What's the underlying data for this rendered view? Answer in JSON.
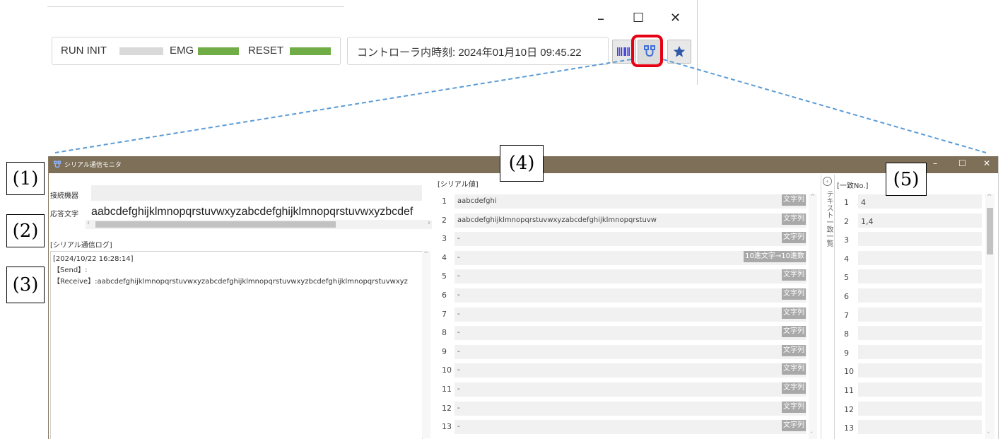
{
  "top": {
    "status": {
      "run_init": "RUN INIT",
      "emg": "EMG",
      "reset": "RESET"
    },
    "controller_time": "コントローラ内時刻: 2024年01月10日 09:45.22",
    "window_controls": {
      "minimize": "–",
      "maximize": "☐",
      "close": "✕"
    },
    "toolbar_icons": [
      "barcode-icon",
      "serial-connector-icon",
      "star-icon"
    ]
  },
  "monitor": {
    "title": "シリアル通信モニタ",
    "window_controls": {
      "minimize": "–",
      "maximize": "☐",
      "close": "✕"
    },
    "connected_device_label": "接続機器",
    "connected_device_value": "",
    "response_label": "応答文字",
    "response_value": "aabcdefghijklmnopqrstuvwxyzabcdefghijklmnopqrstuvwxyzbcdef",
    "log_header": "[シリアル通信ログ]",
    "log_lines": [
      "[2024/10/22 16:28:14]",
      "【Send】:",
      "【Receive】:aabcdefghijklmnopqrstuvwxyzabcdefghijklmnopqrstuvwxyzbcdefghijklmnopqrstuvwxyz"
    ],
    "serial_header": "[シリアル値]",
    "serial_rows": [
      {
        "no": "1",
        "value": "aabcdefghi",
        "tag": "文字列"
      },
      {
        "no": "2",
        "value": "aabcdefghijklmnopqrstuvwxyzabcdefghijklmnopqrstuvw",
        "tag": "文字列"
      },
      {
        "no": "3",
        "value": "-",
        "tag": "文字列"
      },
      {
        "no": "4",
        "value": "-",
        "tag": "10進文字→10進数"
      },
      {
        "no": "5",
        "value": "-",
        "tag": "文字列"
      },
      {
        "no": "6",
        "value": "-",
        "tag": "文字列"
      },
      {
        "no": "7",
        "value": "-",
        "tag": "文字列"
      },
      {
        "no": "8",
        "value": "-",
        "tag": "文字列"
      },
      {
        "no": "9",
        "value": "-",
        "tag": "文字列"
      },
      {
        "no": "10",
        "value": "-",
        "tag": "文字列"
      },
      {
        "no": "11",
        "value": "-",
        "tag": "文字列"
      },
      {
        "no": "12",
        "value": "-",
        "tag": "文字列"
      },
      {
        "no": "13",
        "value": "-",
        "tag": "文字列"
      }
    ],
    "side_tab_label": "テキスト一致一覧",
    "match_header": "[一致No.]",
    "match_rows": [
      {
        "no": "1",
        "value": "4"
      },
      {
        "no": "2",
        "value": "1,4"
      },
      {
        "no": "3",
        "value": ""
      },
      {
        "no": "4",
        "value": ""
      },
      {
        "no": "5",
        "value": ""
      },
      {
        "no": "6",
        "value": ""
      },
      {
        "no": "7",
        "value": ""
      },
      {
        "no": "8",
        "value": ""
      },
      {
        "no": "9",
        "value": ""
      },
      {
        "no": "10",
        "value": ""
      },
      {
        "no": "11",
        "value": ""
      },
      {
        "no": "12",
        "value": ""
      },
      {
        "no": "13",
        "value": ""
      }
    ]
  },
  "callouts": [
    "(1)",
    "(2)",
    "(3)",
    "(4)",
    "(5)"
  ],
  "colors": {
    "status_gray": "#d9d9d9",
    "status_green": "#70ad47",
    "highlight_red": "#e50012",
    "titlebar": "#7d6f58",
    "dashed_line": "#5b9bd5",
    "tag_gray": "#a9a9a9"
  }
}
